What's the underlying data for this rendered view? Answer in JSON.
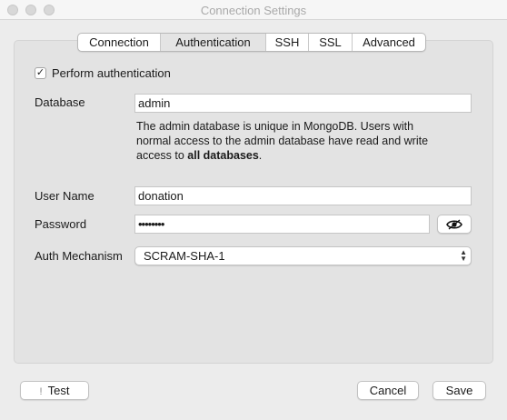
{
  "window": {
    "title": "Connection Settings"
  },
  "tabs": [
    {
      "label": "Connection"
    },
    {
      "label": "Authentication",
      "active": true
    },
    {
      "label": "SSH"
    },
    {
      "label": "SSL"
    },
    {
      "label": "Advanced"
    }
  ],
  "auth": {
    "perform_label": "Perform authentication",
    "perform_checked": true,
    "database_label": "Database",
    "database_value": "admin",
    "help_line1": "The admin database is unique in MongoDB. Users with",
    "help_line2": "normal access to the admin database have read and write",
    "help_line3_prefix": "access to ",
    "help_line3_bold": "all databases",
    "help_line3_suffix": ".",
    "username_label": "User Name",
    "username_value": "donation",
    "password_label": "Password",
    "password_value": "••••••••",
    "mechanism_label": "Auth Mechanism",
    "mechanism_value": "SCRAM-SHA-1"
  },
  "footer": {
    "test_label": "Test",
    "cancel_label": "Cancel",
    "save_label": "Save"
  },
  "icons": {
    "test": "warning-icon",
    "password_toggle": "eye-icon",
    "select": "up-down-chevron-icon"
  }
}
